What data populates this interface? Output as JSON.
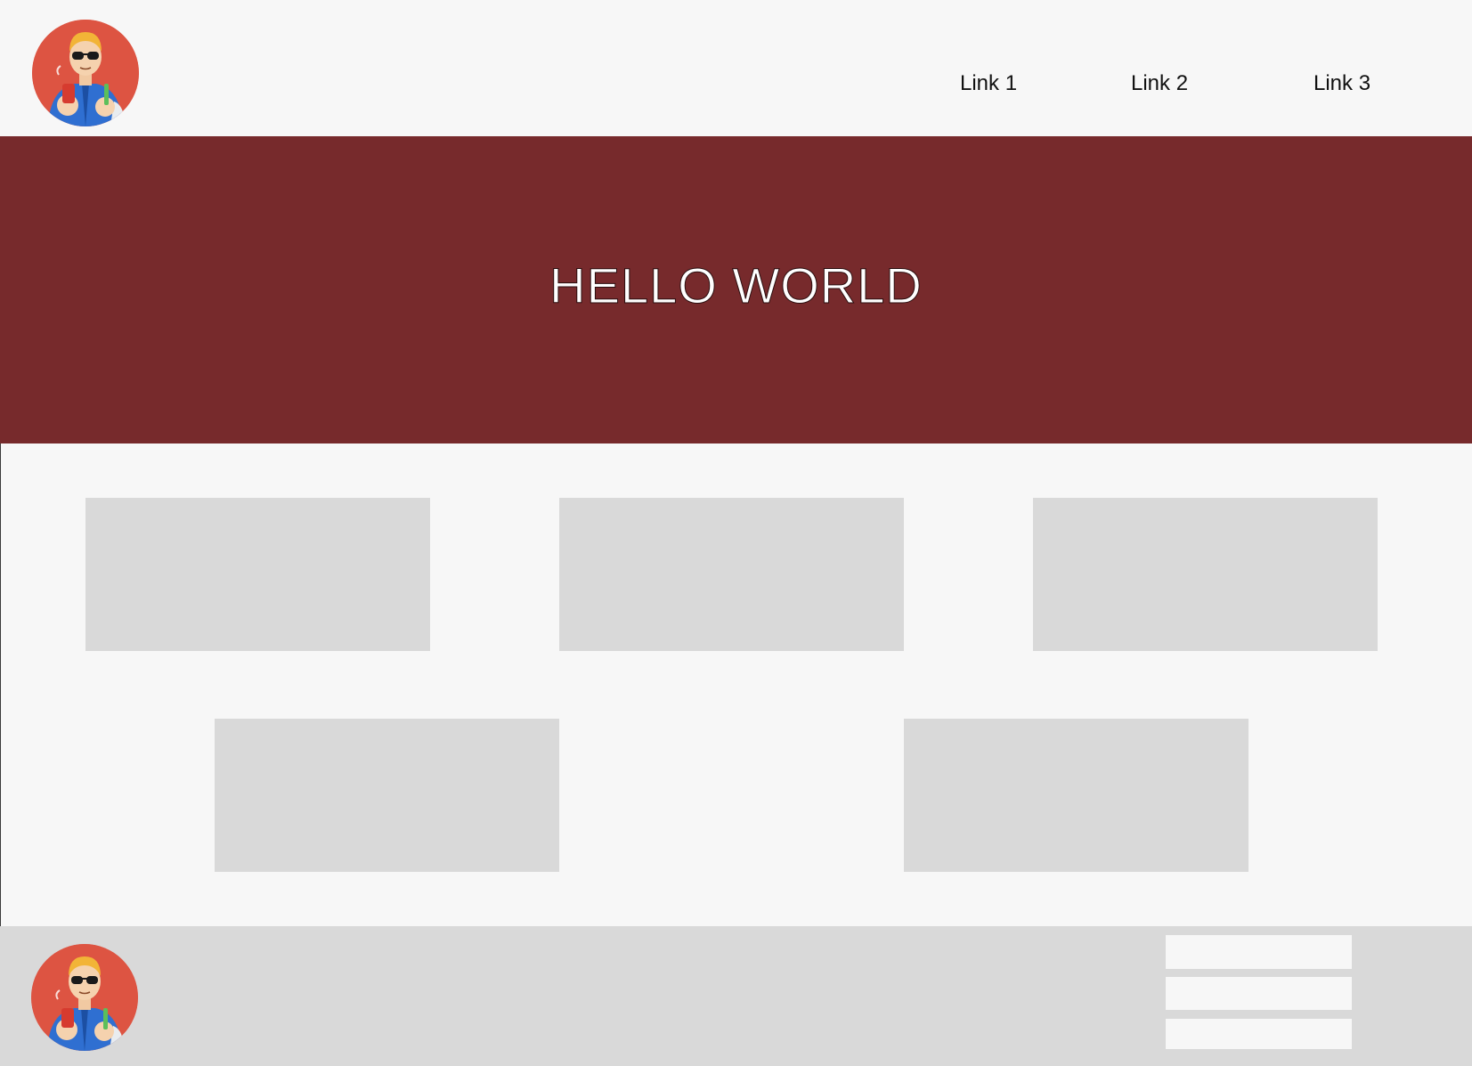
{
  "header": {
    "avatar_icon": "avatar-man-sunglasses-icon",
    "nav": [
      {
        "label": "Link 1"
      },
      {
        "label": "Link 2"
      },
      {
        "label": "Link 3"
      }
    ]
  },
  "hero": {
    "title": "HELLO WORLD",
    "background": "#772a2c"
  },
  "cards": {
    "count": 5,
    "color": "#d9d9d9"
  },
  "footer": {
    "avatar_icon": "avatar-man-sunglasses-icon",
    "background": "#d9d9d9",
    "links": [
      {
        "label": ""
      },
      {
        "label": ""
      },
      {
        "label": ""
      }
    ]
  },
  "colors": {
    "page_background": "#f7f7f7",
    "avatar_background": "#dd5442",
    "jacket": "#2f6fd1"
  }
}
